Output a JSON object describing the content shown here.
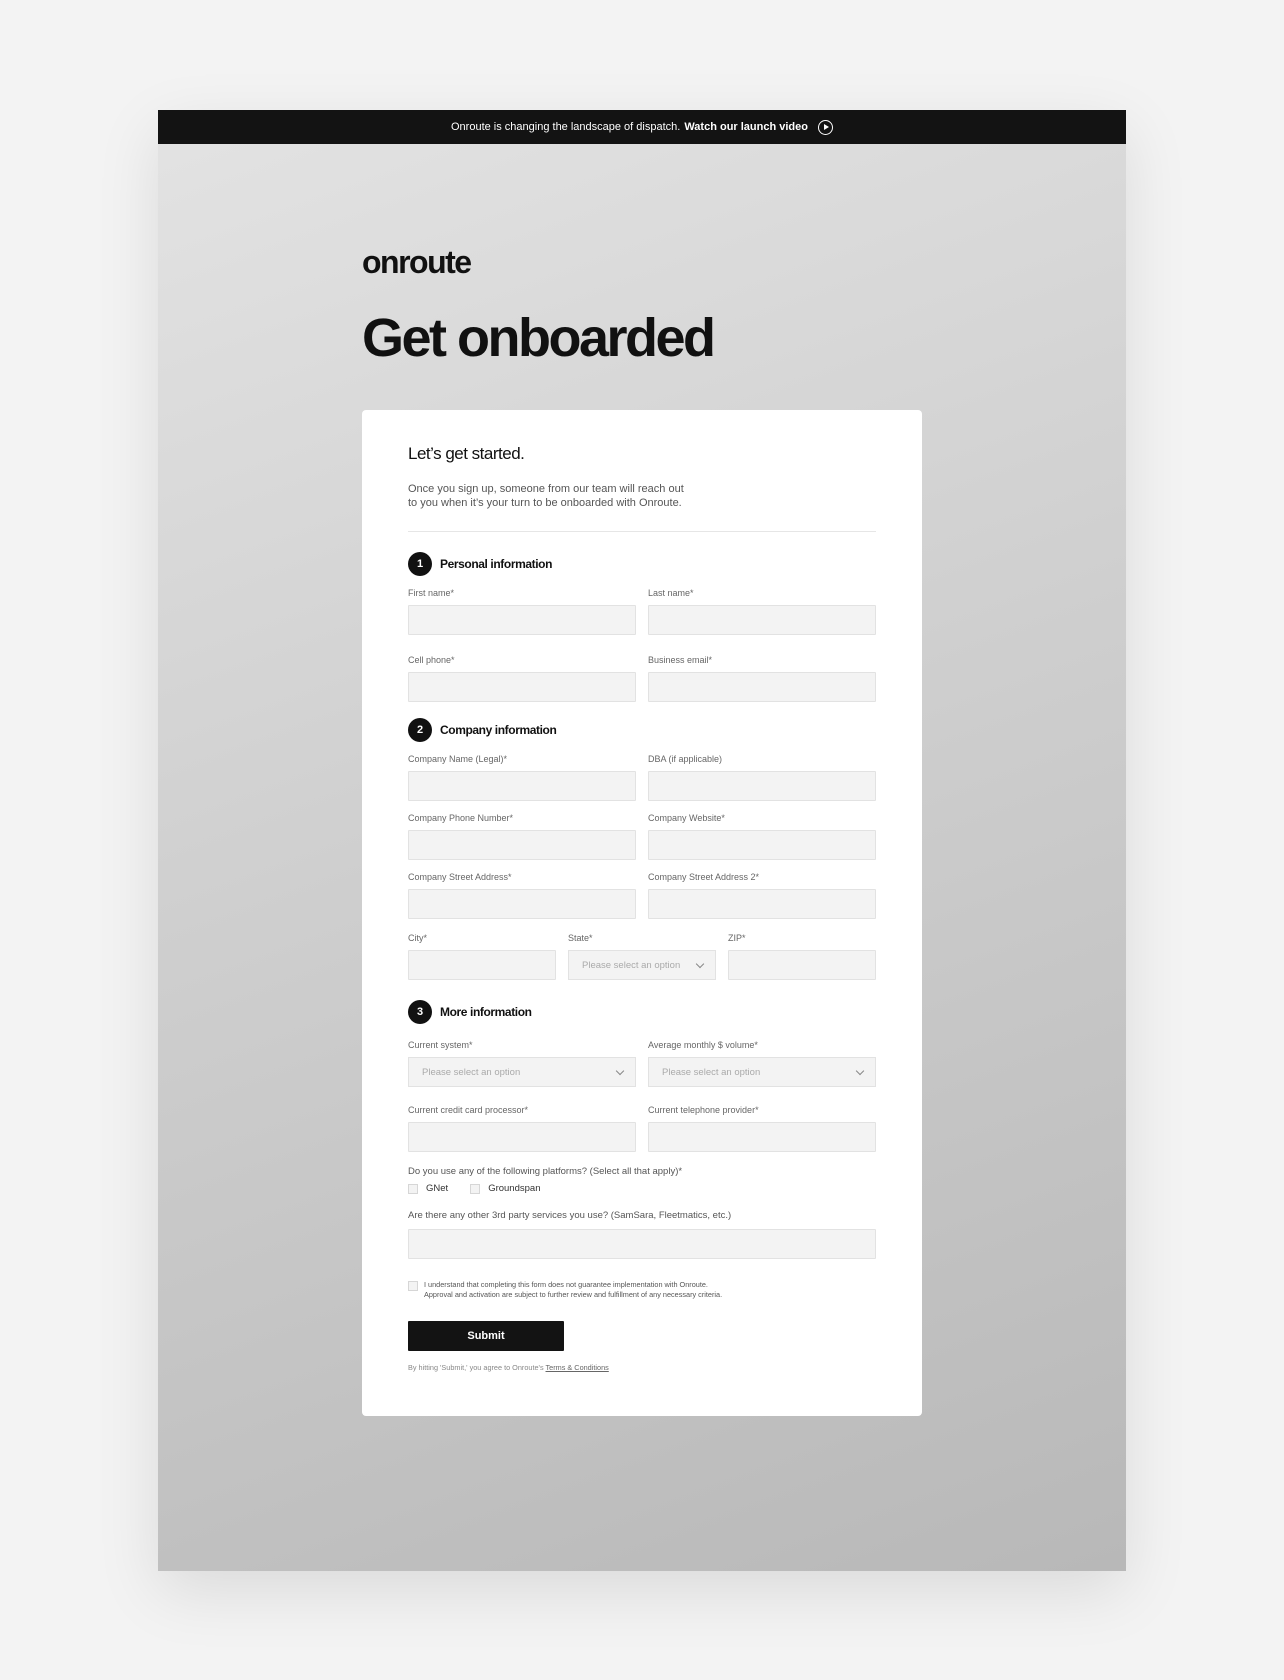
{
  "banner": {
    "text": "Onroute is changing the landscape of dispatch.",
    "link": "Watch our launch video"
  },
  "logo": "onroute",
  "headline": "Get onboarded",
  "card": {
    "title": "Let’s get started.",
    "desc_line1": "Once you sign up, someone from our team will reach out",
    "desc_line2": "to you when it’s your turn to be onboarded with Onroute."
  },
  "sections": [
    {
      "num": "1",
      "title": "Personal information",
      "fields": {
        "first_name": "First name*",
        "last_name": "Last name*",
        "cell_phone": "Cell phone*",
        "business_email": "Business email*"
      }
    },
    {
      "num": "2",
      "title": "Company information",
      "fields": {
        "company_name": "Company Name (Legal)*",
        "dba": "DBA (if applicable)",
        "company_phone": "Company Phone Number*",
        "company_website": "Company Website*",
        "street": "Company Street Address*",
        "street2": "Company Street Address 2*",
        "city": "City*",
        "state": "State*",
        "zip": "ZIP*"
      }
    },
    {
      "num": "3",
      "title": "More information",
      "fields": {
        "current_system": "Current system*",
        "monthly_volume": "Average monthly $ volume*",
        "cc_processor": "Current credit card processor*",
        "telephone_provider": "Current telephone provider*",
        "platforms_q": "Do you use any of the following platforms? (Select all that apply)*",
        "third_party_q": "Are there any other 3rd party services you use? (SamSara, Fleetmatics, etc.)"
      },
      "platforms": [
        "GNet",
        "Groundspan"
      ]
    }
  ],
  "select_placeholder": "Please select an option",
  "agree_line1": "I understand that completing this form does not guarantee implementation with Onroute.",
  "agree_line2": "Approval and activation are subject to further review and fulfillment of any necessary criteria.",
  "submit_label": "Submit",
  "legal_text": "By hitting 'Submit,' you agree to Onroute's",
  "legal_link": "Terms & Conditions"
}
